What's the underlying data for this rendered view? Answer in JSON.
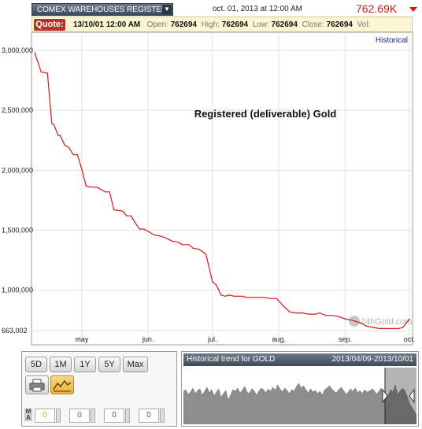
{
  "header": {
    "instrument": "COMEX WAREHOUSES REGISTERED $",
    "instrument_caret": "▼",
    "datetime": "oct. 01, 2013 at 12:00 AM",
    "last_price": "762.69K",
    "price_color": "#d01818"
  },
  "quote": {
    "button": "Quote:",
    "date": "13/10/01 12:00 AM",
    "open_label": "Open:",
    "open": "762694",
    "high_label": "High:",
    "high": "762694",
    "low_label": "Low:",
    "low": "762694",
    "close_label": "Close:",
    "close": "762694",
    "vol_label": "Vol:"
  },
  "historical_link": "Historical",
  "watermark": "24hGold.com",
  "chart_data": {
    "type": "line",
    "title": "Registered (deliverable) Gold",
    "line_color": "#d01818",
    "y_ticks": [
      {
        "label": "3,000,000",
        "value": 3000000
      },
      {
        "label": "2,500,000",
        "value": 2500000
      },
      {
        "label": "2,000,000",
        "value": 2000000
      },
      {
        "label": "1,500,000",
        "value": 1500000
      },
      {
        "label": "1,000,000",
        "value": 1000000
      },
      {
        "label": "663,002",
        "value": 663002
      }
    ],
    "x_ticks": [
      {
        "label": "may",
        "value": "2013-05-01"
      },
      {
        "label": "jun.",
        "value": "2013-06-01"
      },
      {
        "label": "jul.",
        "value": "2013-07-01"
      },
      {
        "label": "aug.",
        "value": "2013-08-01"
      },
      {
        "label": "sep.",
        "value": "2013-09-01"
      },
      {
        "label": "oct.",
        "value": "2013-10-01"
      }
    ],
    "x_range": [
      "2013-04-09",
      "2013-10-01"
    ],
    "y_range": [
      663002,
      3000000
    ],
    "grid": true,
    "x": [
      "2013-04-09",
      "2013-04-10",
      "2013-04-12",
      "2013-04-15",
      "2013-04-17",
      "2013-04-18",
      "2013-04-20",
      "2013-04-21",
      "2013-04-23",
      "2013-04-25",
      "2013-04-27",
      "2013-04-29",
      "2013-05-01",
      "2013-05-03",
      "2013-05-05",
      "2013-05-07",
      "2013-05-08",
      "2013-05-12",
      "2013-05-14",
      "2013-05-16",
      "2013-05-20",
      "2013-05-22",
      "2013-05-24",
      "2013-05-26",
      "2013-05-28",
      "2013-05-30",
      "2013-06-01",
      "2013-06-04",
      "2013-06-07",
      "2013-06-10",
      "2013-06-12",
      "2013-06-15",
      "2013-06-17",
      "2013-06-20",
      "2013-06-22",
      "2013-06-25",
      "2013-06-28",
      "2013-07-01",
      "2013-07-03",
      "2013-07-05",
      "2013-07-07",
      "2013-07-09",
      "2013-07-11",
      "2013-07-13",
      "2013-07-15",
      "2013-07-17",
      "2013-07-20",
      "2013-07-22",
      "2013-07-25",
      "2013-07-28",
      "2013-07-31",
      "2013-08-03",
      "2013-08-06",
      "2013-08-09",
      "2013-08-12",
      "2013-08-15",
      "2013-08-18",
      "2013-08-20",
      "2013-08-23",
      "2013-08-26",
      "2013-08-29",
      "2013-09-01",
      "2013-09-04",
      "2013-09-06",
      "2013-09-09",
      "2013-09-11",
      "2013-09-14",
      "2013-09-17",
      "2013-09-20",
      "2013-09-23",
      "2013-09-26",
      "2013-09-28",
      "2013-10-01"
    ],
    "y": [
      2980000,
      2930000,
      2820000,
      2810000,
      2390000,
      2380000,
      2290000,
      2290000,
      2210000,
      2190000,
      2130000,
      2130000,
      2010000,
      1870000,
      1860000,
      1860000,
      1860000,
      1820000,
      1820000,
      1670000,
      1660000,
      1620000,
      1620000,
      1560000,
      1510000,
      1510000,
      1490000,
      1460000,
      1450000,
      1430000,
      1410000,
      1400000,
      1380000,
      1380000,
      1350000,
      1340000,
      1300000,
      1070000,
      1040000,
      960000,
      950000,
      960000,
      950000,
      950000,
      950000,
      940000,
      940000,
      940000,
      940000,
      930000,
      930000,
      870000,
      820000,
      810000,
      810000,
      800000,
      800000,
      810000,
      790000,
      790000,
      780000,
      760000,
      750000,
      740000,
      720000,
      700000,
      690000,
      680000,
      680000,
      680000,
      680000,
      690000,
      760000
    ]
  },
  "controls": {
    "periods": [
      "5D",
      "1M",
      "1Y",
      "5Y",
      "Max"
    ],
    "ma_label": "MA",
    "ma_values": [
      "0",
      "0",
      "0",
      "0"
    ],
    "ma_colors": [
      "#c8b400",
      "#2a9a2a",
      "#8a2a9a",
      "#2a5aaa"
    ]
  },
  "overview": {
    "title": "Historical trend for GOLD",
    "range": "2013/04/09-2013/10/01"
  }
}
